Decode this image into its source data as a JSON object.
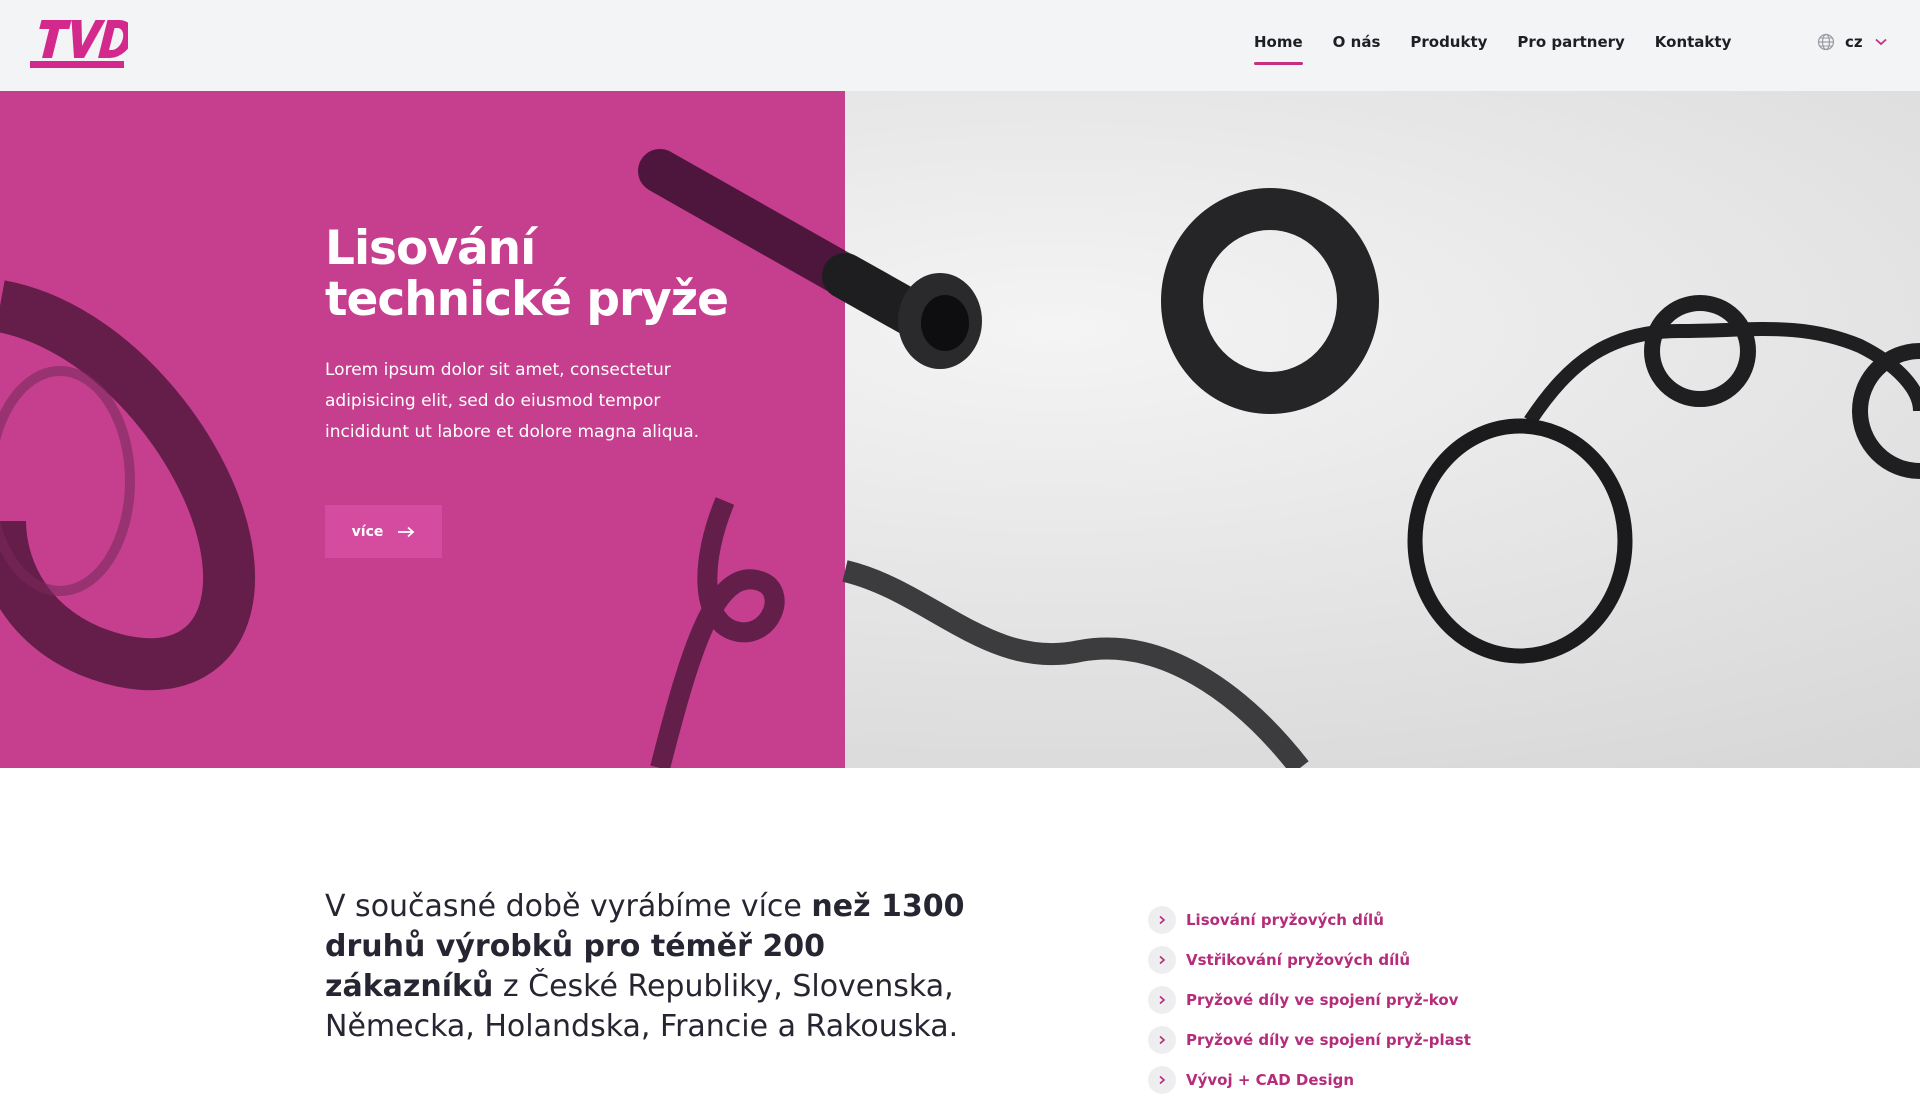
{
  "header": {
    "logo_text": "TVD",
    "nav": [
      {
        "label": "Home",
        "active": true
      },
      {
        "label": "O nás"
      },
      {
        "label": "Produkty"
      },
      {
        "label": "Pro partnery"
      },
      {
        "label": "Kontakty"
      }
    ],
    "language": "cz"
  },
  "hero": {
    "title_line1": "Lisování",
    "title_line2": "technické pryže",
    "body": "Lorem ipsum dolor sit amet, consectetur adipisicing elit, sed do eiusmod tempor incididunt ut labore et dolore magna aliqua.",
    "button_label": "více"
  },
  "intro": {
    "part1": "V současné době vyrábíme více ",
    "bold": "než 1300 druhů výrobků pro téměř 200 zákazníků",
    "part2": " z České Republiky, Slovenska, Německa, Holandska, Francie a Rakouska."
  },
  "services": [
    {
      "label": "Lisování pryžových dílů"
    },
    {
      "label": "Vstřikování pryžových dílů"
    },
    {
      "label": "Pryžové díly ve spojení pryž-kov"
    },
    {
      "label": "Pryžové díly ve spojení pryž-plast"
    },
    {
      "label": "Vývoj + CAD Design"
    }
  ],
  "colors": {
    "brand": "#d4298c",
    "hero_overlay": "#c63f8e",
    "button": "#d44ba0",
    "link": "#b42c7a",
    "header_bg": "#f3f4f6"
  }
}
